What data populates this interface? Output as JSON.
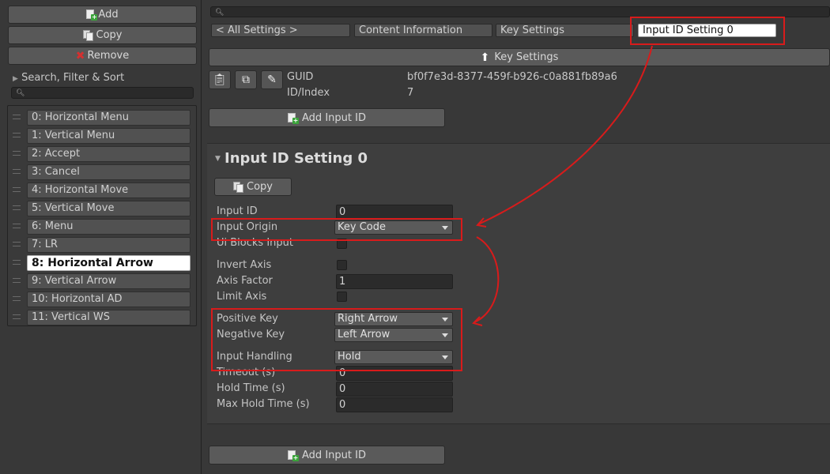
{
  "left": {
    "add_label": "Add",
    "copy_label": "Copy",
    "remove_label": "Remove",
    "filter_label": "Search, Filter & Sort",
    "items": [
      "0: Horizontal Menu",
      "1: Vertical Menu",
      "2: Accept",
      "3: Cancel",
      "4: Horizontal Move",
      "5: Vertical Move",
      "6: Menu",
      "7: LR",
      "8: Horizontal Arrow",
      "9: Vertical Arrow",
      "10: Horizontal AD",
      "11: Vertical WS"
    ],
    "selected_index": 8
  },
  "breadcrumb": {
    "all_settings": "< All Settings >",
    "content_information": "Content Information",
    "key_settings": "Key Settings",
    "current": "Input ID Setting 0"
  },
  "header": {
    "key_settings_label": "Key Settings",
    "guid_label": "GUID",
    "guid_value": "bf0f7e3d-8377-459f-b926-c0a881fb89a6",
    "index_label": "ID/Index",
    "index_value": "7",
    "add_input_id_label": "Add Input ID"
  },
  "setting": {
    "title": "Input ID Setting 0",
    "copy_label": "Copy",
    "input_id_label": "Input ID",
    "input_id_value": "0",
    "input_origin_label": "Input Origin",
    "input_origin_value": "Key Code",
    "ui_blocks_label": "Ui Blocks Input",
    "invert_axis_label": "Invert Axis",
    "axis_factor_label": "Axis Factor",
    "axis_factor_value": "1",
    "limit_axis_label": "Limit Axis",
    "positive_key_label": "Positive Key",
    "positive_key_value": "Right Arrow",
    "negative_key_label": "Negative Key",
    "negative_key_value": "Left Arrow",
    "input_handling_label": "Input Handling",
    "input_handling_value": "Hold",
    "timeout_label": "Timeout (s)",
    "timeout_value": "0",
    "hold_time_label": "Hold Time (s)",
    "hold_time_value": "0",
    "max_hold_time_label": "Max Hold Time (s)",
    "max_hold_time_value": "0"
  },
  "footer": {
    "add_input_id_label": "Add Input ID"
  },
  "colors": {
    "annotation": "#d81b1b",
    "panel": "#383838",
    "selected_item": "#ffffff"
  }
}
